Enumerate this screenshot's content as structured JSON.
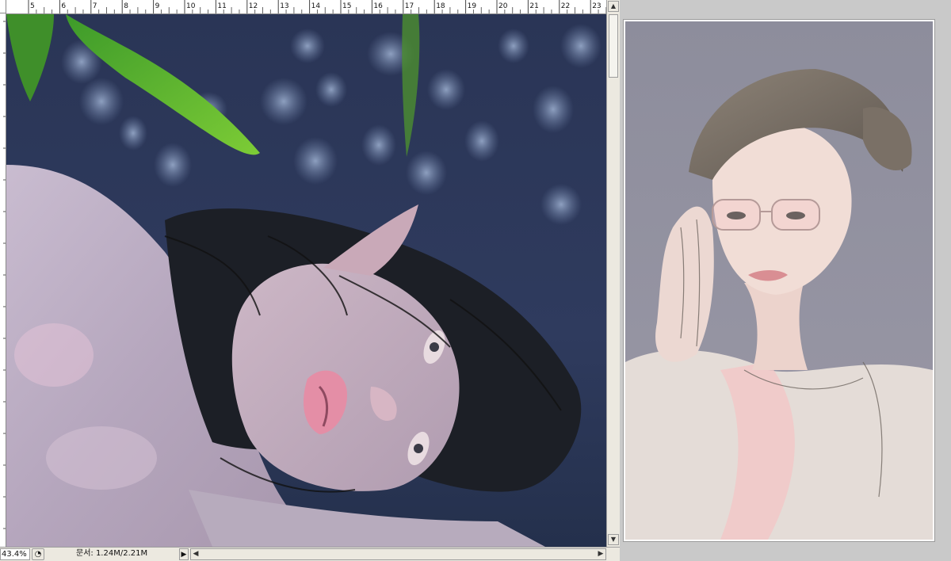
{
  "document": {
    "ruler_ticks": [
      "5",
      "6",
      "7",
      "8",
      "9",
      "10",
      "11",
      "12",
      "13",
      "14",
      "15",
      "16",
      "17",
      "18",
      "19",
      "20",
      "21",
      "22",
      "23"
    ],
    "canvas_icon": "painting-canvas"
  },
  "status": {
    "zoom": "43.4%",
    "doc_info": "문서: 1.24M/2.21M",
    "menu_arrow": "▶",
    "scroll_left": "◀",
    "scroll_right": "▶"
  },
  "scroll": {
    "up": "▲",
    "down": "▼"
  },
  "reference": {
    "icon": "reference-painting"
  },
  "colors": {
    "ui_bg": "#d4d0c8",
    "canvas_bg": "#2c3654",
    "ref_bg": "#8f8f9c"
  }
}
